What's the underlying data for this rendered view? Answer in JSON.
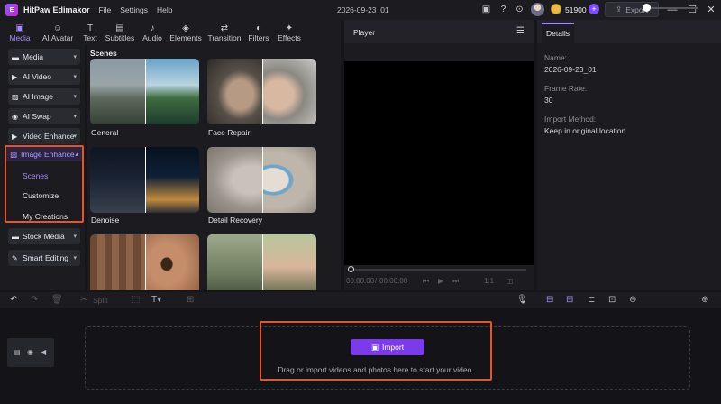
{
  "app": {
    "name": "HitPaw Edimakor",
    "logo_text": "E",
    "menu": [
      "File",
      "Settings",
      "Help"
    ],
    "project_title": "2026-09-23_01",
    "credits": "51900",
    "export_label": "Export"
  },
  "tabs": [
    {
      "label": "Media",
      "icon": "media-icon",
      "glyph": "▣",
      "active": true
    },
    {
      "label": "AI Avatar",
      "icon": "avatar-icon",
      "glyph": "☺",
      "active": false
    },
    {
      "label": "Text",
      "icon": "text-icon",
      "glyph": "T",
      "active": false
    },
    {
      "label": "Subtitles",
      "icon": "subtitles-icon",
      "glyph": "▤",
      "active": false
    },
    {
      "label": "Audio",
      "icon": "audio-icon",
      "glyph": "♪",
      "active": false
    },
    {
      "label": "Elements",
      "icon": "elements-icon",
      "glyph": "◈",
      "active": false
    },
    {
      "label": "Transition",
      "icon": "transition-icon",
      "glyph": "⇄",
      "active": false
    },
    {
      "label": "Filters",
      "icon": "filters-icon",
      "glyph": "◐",
      "active": false
    },
    {
      "label": "Effects",
      "icon": "effects-icon",
      "glyph": "✦",
      "active": false
    }
  ],
  "sidebar": {
    "items": [
      {
        "label": "Media",
        "glyph": "▬"
      },
      {
        "label": "AI Video",
        "glyph": "▶"
      },
      {
        "label": "AI Image",
        "glyph": "▨"
      },
      {
        "label": "AI Swap",
        "glyph": "◉"
      },
      {
        "label": "Video Enhance",
        "glyph": "▶"
      }
    ],
    "image_enhance": {
      "label": "Image Enhance",
      "subitems": [
        {
          "label": "Scenes",
          "active": true
        },
        {
          "label": "Customize",
          "active": false
        },
        {
          "label": "My Creations",
          "active": false
        }
      ]
    },
    "bottom_items": [
      {
        "label": "Stock Media",
        "glyph": "▬"
      },
      {
        "label": "Smart Editing",
        "glyph": "✎"
      }
    ]
  },
  "scenes": {
    "title": "Scenes",
    "cards": [
      {
        "label": "General"
      },
      {
        "label": "Face Repair"
      },
      {
        "label": "Denoise"
      },
      {
        "label": "Detail Recovery"
      },
      {
        "label": ""
      },
      {
        "label": ""
      }
    ]
  },
  "player": {
    "title": "Player",
    "time_current": "00:00:00",
    "time_total": "00:00:00",
    "ratio": "1:1"
  },
  "details": {
    "tab": "Details",
    "fields": [
      {
        "label": "Name:",
        "value": "2026-09-23_01"
      },
      {
        "label": "Frame Rate:",
        "value": "30"
      },
      {
        "label": "Import Method:",
        "value": "Keep in original location"
      }
    ]
  },
  "timeline": {
    "split_label": "Split",
    "import_label": "Import",
    "import_hint": "Drag or import videos and photos here to start your video."
  },
  "colors": {
    "accent": "#7c3aed",
    "accent_light": "#a78bfa",
    "highlight_box": "#e4552e"
  }
}
